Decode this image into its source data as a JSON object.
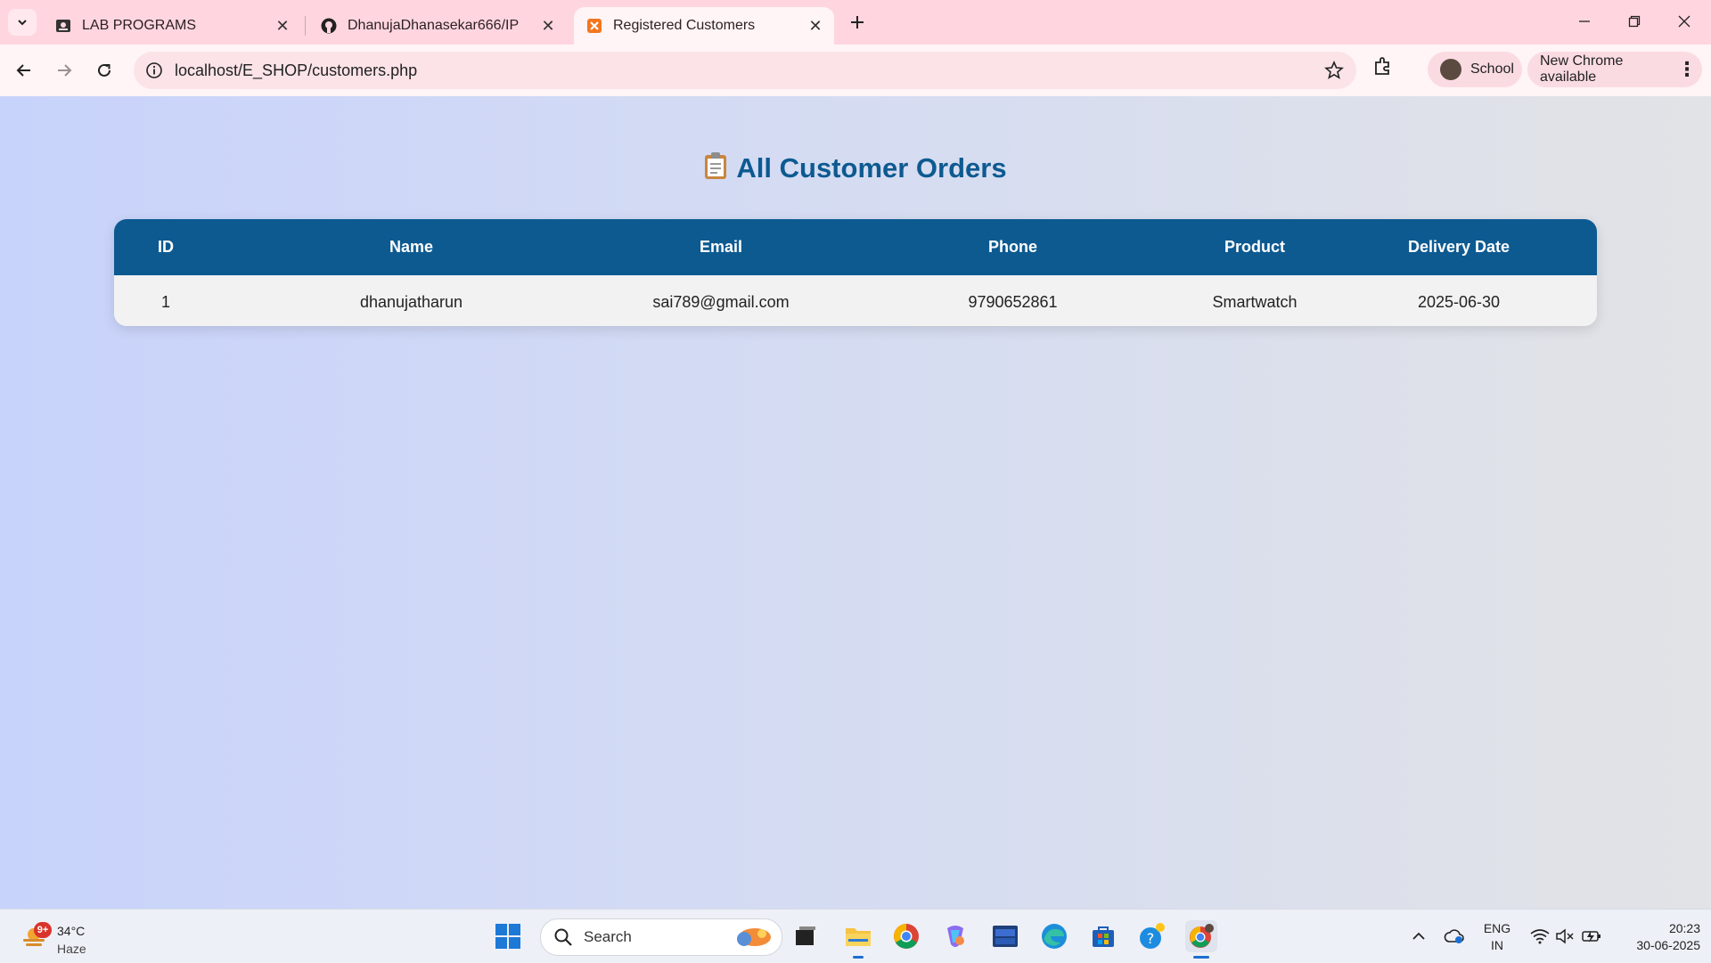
{
  "browser": {
    "tabs": [
      {
        "label": "LAB PROGRAMS",
        "icon": "classroom-icon",
        "active": false
      },
      {
        "label": "DhanujaDhanasekar666/IP",
        "icon": "github-icon",
        "active": false
      },
      {
        "label": "Registered Customers",
        "icon": "xampp-icon",
        "active": true
      }
    ],
    "url": "localhost/E_SHOP/customers.php",
    "profile_label": "School",
    "update_label": "New Chrome available"
  },
  "page": {
    "title": "All Customer Orders",
    "title_icon": "clipboard-icon",
    "table": {
      "headers": [
        "ID",
        "Name",
        "Email",
        "Phone",
        "Product",
        "Delivery Date"
      ],
      "rows": [
        [
          "1",
          "dhanujatharun",
          "sai789@gmail.com",
          "9790652861",
          "Smartwatch",
          "2025-06-30"
        ]
      ]
    }
  },
  "taskbar": {
    "weather": {
      "badge": "9+",
      "temp": "34°C",
      "condition": "Haze"
    },
    "search_placeholder": "Search",
    "lang": {
      "line1": "ENG",
      "line2": "IN"
    },
    "clock": {
      "time": "20:23",
      "date": "30-06-2025"
    }
  },
  "colors": {
    "header_bg": "#0d5a91",
    "title_color": "#0d5a91",
    "titlebar_bg": "#ffd6df"
  }
}
